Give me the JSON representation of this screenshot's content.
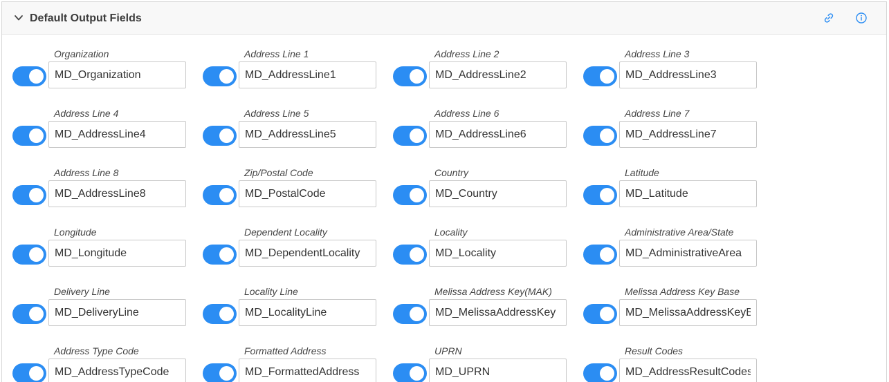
{
  "panel": {
    "title": "Default Output Fields",
    "colors": {
      "accent": "#2b8df3",
      "header_bg": "#f8f8f8"
    }
  },
  "fields": [
    {
      "label": "Organization",
      "value": "MD_Organization",
      "enabled": true
    },
    {
      "label": "Address Line 1",
      "value": "MD_AddressLine1",
      "enabled": true
    },
    {
      "label": "Address Line 2",
      "value": "MD_AddressLine2",
      "enabled": true
    },
    {
      "label": "Address Line 3",
      "value": "MD_AddressLine3",
      "enabled": true
    },
    {
      "label": "Address Line 4",
      "value": "MD_AddressLine4",
      "enabled": true
    },
    {
      "label": "Address Line 5",
      "value": "MD_AddressLine5",
      "enabled": true
    },
    {
      "label": "Address Line 6",
      "value": "MD_AddressLine6",
      "enabled": true
    },
    {
      "label": "Address Line 7",
      "value": "MD_AddressLine7",
      "enabled": true
    },
    {
      "label": "Address Line 8",
      "value": "MD_AddressLine8",
      "enabled": true
    },
    {
      "label": "Zip/Postal Code",
      "value": "MD_PostalCode",
      "enabled": true
    },
    {
      "label": "Country",
      "value": "MD_Country",
      "enabled": true
    },
    {
      "label": "Latitude",
      "value": "MD_Latitude",
      "enabled": true
    },
    {
      "label": "Longitude",
      "value": "MD_Longitude",
      "enabled": true
    },
    {
      "label": "Dependent Locality",
      "value": "MD_DependentLocality",
      "enabled": true
    },
    {
      "label": "Locality",
      "value": "MD_Locality",
      "enabled": true
    },
    {
      "label": "Administrative Area/State",
      "value": "MD_AdministrativeArea",
      "enabled": true
    },
    {
      "label": "Delivery Line",
      "value": "MD_DeliveryLine",
      "enabled": true
    },
    {
      "label": "Locality Line",
      "value": "MD_LocalityLine",
      "enabled": true
    },
    {
      "label": "Melissa Address Key(MAK)",
      "value": "MD_MelissaAddressKey",
      "enabled": true
    },
    {
      "label": "Melissa Address Key Base",
      "value": "MD_MelissaAddressKeyBa",
      "enabled": true
    },
    {
      "label": "Address Type Code",
      "value": "MD_AddressTypeCode",
      "enabled": true
    },
    {
      "label": "Formatted Address",
      "value": "MD_FormattedAddress",
      "enabled": true
    },
    {
      "label": "UPRN",
      "value": "MD_UPRN",
      "enabled": true
    },
    {
      "label": "Result Codes",
      "value": "MD_AddressResultCodes",
      "enabled": true
    }
  ]
}
